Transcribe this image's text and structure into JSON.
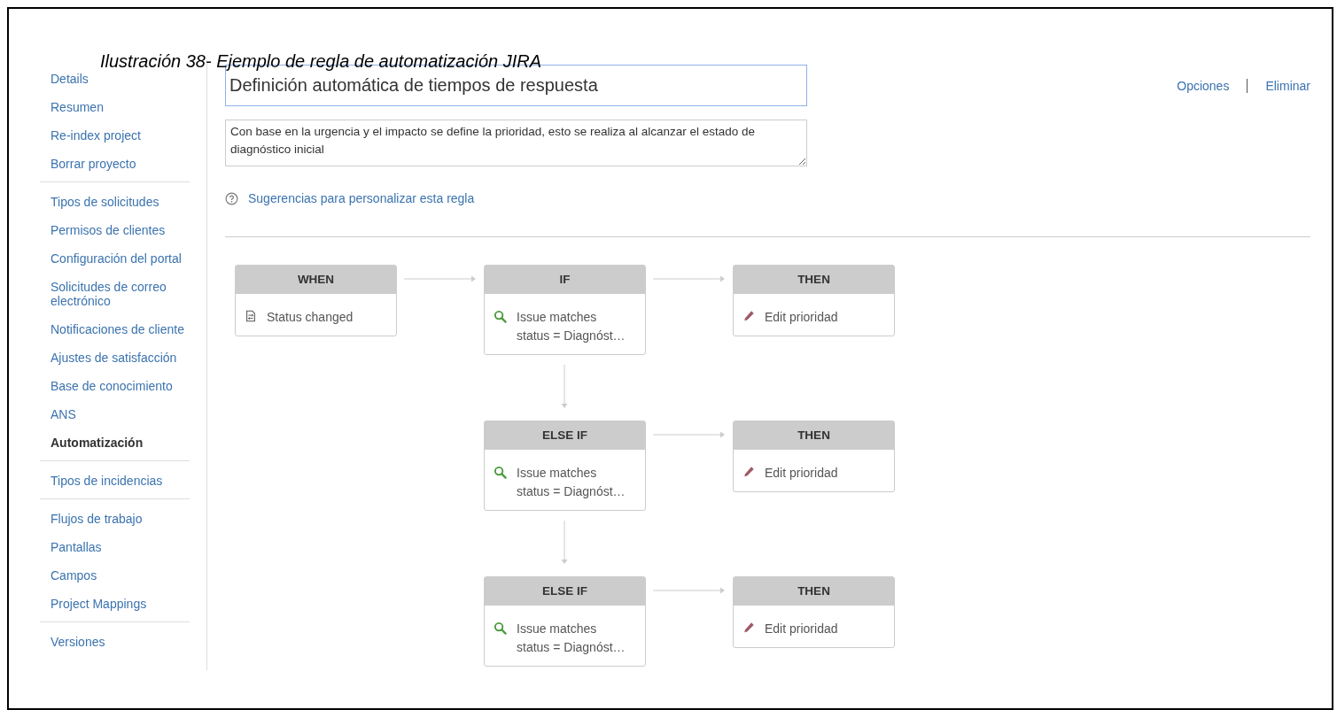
{
  "caption": "Ilustración 38- Ejemplo de regla de automatización JIRA",
  "sidebar": {
    "groups": [
      [
        {
          "label": "Details",
          "selected": false
        },
        {
          "label": "Resumen",
          "selected": false
        },
        {
          "label": "Re-index project",
          "selected": false
        },
        {
          "label": "Borrar proyecto",
          "selected": false
        }
      ],
      [
        {
          "label": "Tipos de solicitudes",
          "selected": false
        },
        {
          "label": "Permisos de clientes",
          "selected": false
        },
        {
          "label": "Configuración del portal",
          "selected": false
        },
        {
          "label": "Solicitudes de correo electrónico",
          "selected": false
        },
        {
          "label": "Notificaciones de cliente",
          "selected": false
        },
        {
          "label": "Ajustes de satisfacción",
          "selected": false
        },
        {
          "label": "Base de conocimiento",
          "selected": false
        },
        {
          "label": "ANS",
          "selected": false
        },
        {
          "label": "Automatización",
          "selected": true
        }
      ],
      [
        {
          "label": "Tipos de incidencias",
          "selected": false
        }
      ],
      [
        {
          "label": "Flujos de trabajo",
          "selected": false
        },
        {
          "label": "Pantallas",
          "selected": false
        },
        {
          "label": "Campos",
          "selected": false
        },
        {
          "label": "Project Mappings",
          "selected": false
        }
      ],
      [
        {
          "label": "Versiones",
          "selected": false
        }
      ]
    ]
  },
  "rule": {
    "name": "Definición automática de tiempos de respuesta",
    "description": "Con base en la urgencia y el impacto se define la prioridad, esto se realiza al alcanzar el estado de diagnóstico inicial",
    "help_link": "Sugerencias para personalizar esta regla"
  },
  "actions": [
    "Opciones",
    "Eliminar"
  ],
  "diagram": {
    "rows": [
      {
        "trigger": {
          "kind": "trigger",
          "header": "WHEN",
          "lines": [
            "Status changed"
          ]
        },
        "condition": {
          "kind": "condition",
          "header": "IF",
          "lines": [
            "Issue matches",
            "status = Diagnóst…"
          ]
        },
        "action": {
          "kind": "action",
          "header": "THEN",
          "lines": [
            "Edit prioridad"
          ]
        }
      },
      {
        "condition": {
          "kind": "condition",
          "header": "ELSE IF",
          "lines": [
            "Issue matches",
            "status = Diagnóst…"
          ]
        },
        "action": {
          "kind": "action",
          "header": "THEN",
          "lines": [
            "Edit prioridad"
          ]
        }
      },
      {
        "condition": {
          "kind": "condition",
          "header": "ELSE IF",
          "lines": [
            "Issue matches",
            "status = Diagnóst…"
          ]
        },
        "action": {
          "kind": "action",
          "header": "THEN",
          "lines": [
            "Edit prioridad"
          ]
        }
      }
    ]
  }
}
